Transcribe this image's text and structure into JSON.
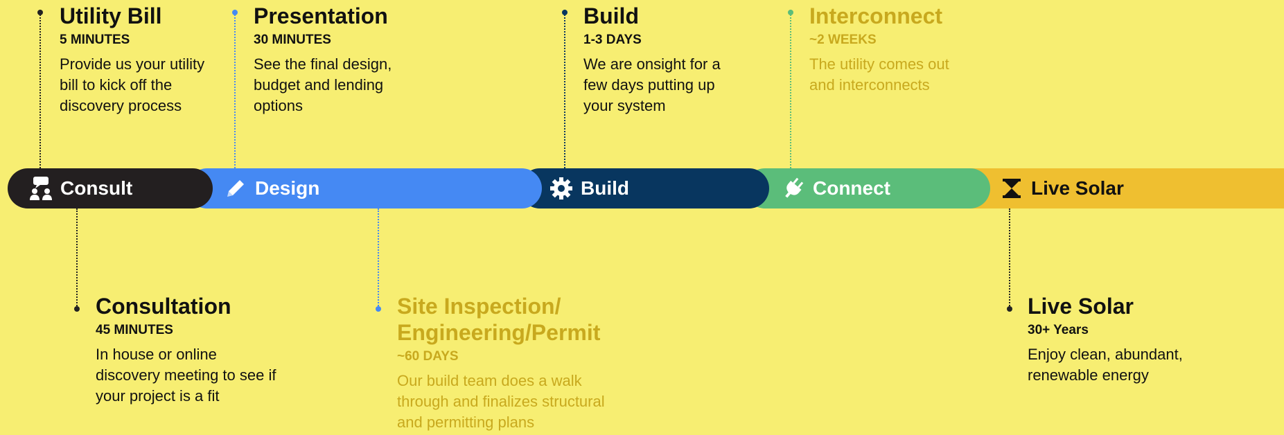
{
  "colors": {
    "background": "#f7ee72",
    "consult": "#231f20",
    "design": "#4589f3",
    "build": "#08365f",
    "connect": "#5bbd7a",
    "live_solar": "#efbf30",
    "muted_text": "#c8a91e"
  },
  "phases": [
    {
      "label": "Consult",
      "icon": "consult-people-icon"
    },
    {
      "label": "Design",
      "icon": "pencil-icon"
    },
    {
      "label": "Build",
      "icon": "gear-icon"
    },
    {
      "label": "Connect",
      "icon": "plug-icon"
    },
    {
      "label": "Live Solar",
      "icon": "hourglass-icon"
    }
  ],
  "steps": {
    "utility_bill": {
      "title": "Utility Bill",
      "duration": "5 MINUTES",
      "desc": "Provide us your utility bill to kick off the discovery process"
    },
    "presentation": {
      "title": "Presentation",
      "duration": "30 MINUTES",
      "desc": "See the final design, budget and lending options"
    },
    "build": {
      "title": "Build",
      "duration": "1-3 DAYS",
      "desc": "We are onsight for a few days putting up your system"
    },
    "interconnect": {
      "title": "Interconnect",
      "duration": "~2 WEEKS",
      "desc": "The utility comes out and interconnects"
    },
    "consultation": {
      "title": "Consultation",
      "duration": "45 MINUTES",
      "desc": "In house or online discovery meeting to see if your project is a fit"
    },
    "site_inspection": {
      "title": "Site Inspection/ Engineering/Permit",
      "duration": "~60 DAYS",
      "desc": "Our build team does a walk through and finalizes structural and permitting plans"
    },
    "live_solar": {
      "title": "Live Solar",
      "duration": "30+ Years",
      "desc": "Enjoy clean, abundant, renewable energy"
    }
  }
}
